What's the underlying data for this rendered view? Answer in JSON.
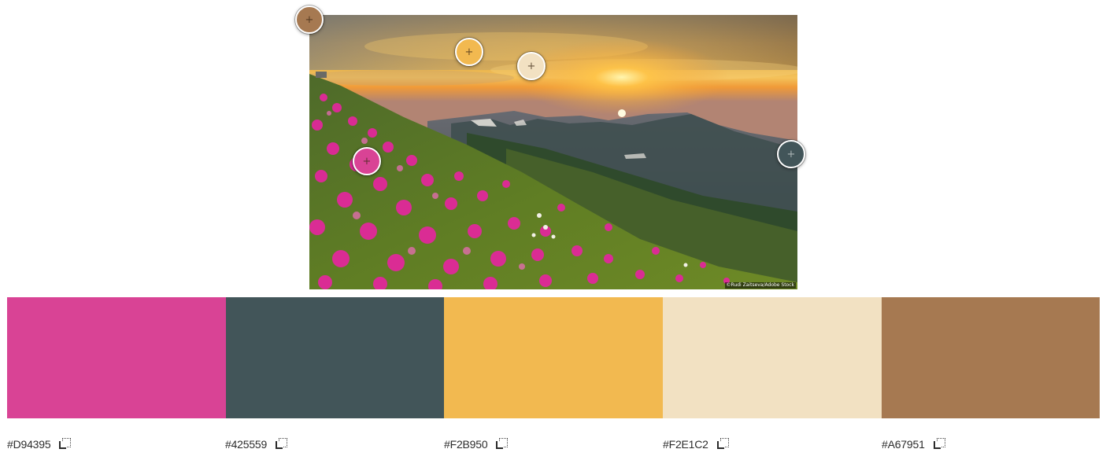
{
  "photo": {
    "credit": "©Rudi Zaitseva/Adobe Stock"
  },
  "pickers": [
    {
      "name": "picker-brown",
      "color": "#A67951"
    },
    {
      "name": "picker-yellow",
      "color": "#F2B950"
    },
    {
      "name": "picker-cream",
      "color": "#F2E1C2"
    },
    {
      "name": "picker-pink",
      "color": "#D94395"
    },
    {
      "name": "picker-slate",
      "color": "#425559"
    }
  ],
  "palette": {
    "swatches": [
      {
        "hex": "#D94395",
        "color": "#D94395"
      },
      {
        "hex": "#425559",
        "color": "#425559"
      },
      {
        "hex": "#F2B950",
        "color": "#F2B950"
      },
      {
        "hex": "#F2E1C2",
        "color": "#F2E1C2"
      },
      {
        "hex": "#A67951",
        "color": "#A67951"
      }
    ]
  },
  "icons": {
    "copy": "copy-icon",
    "crosshair": "+"
  }
}
